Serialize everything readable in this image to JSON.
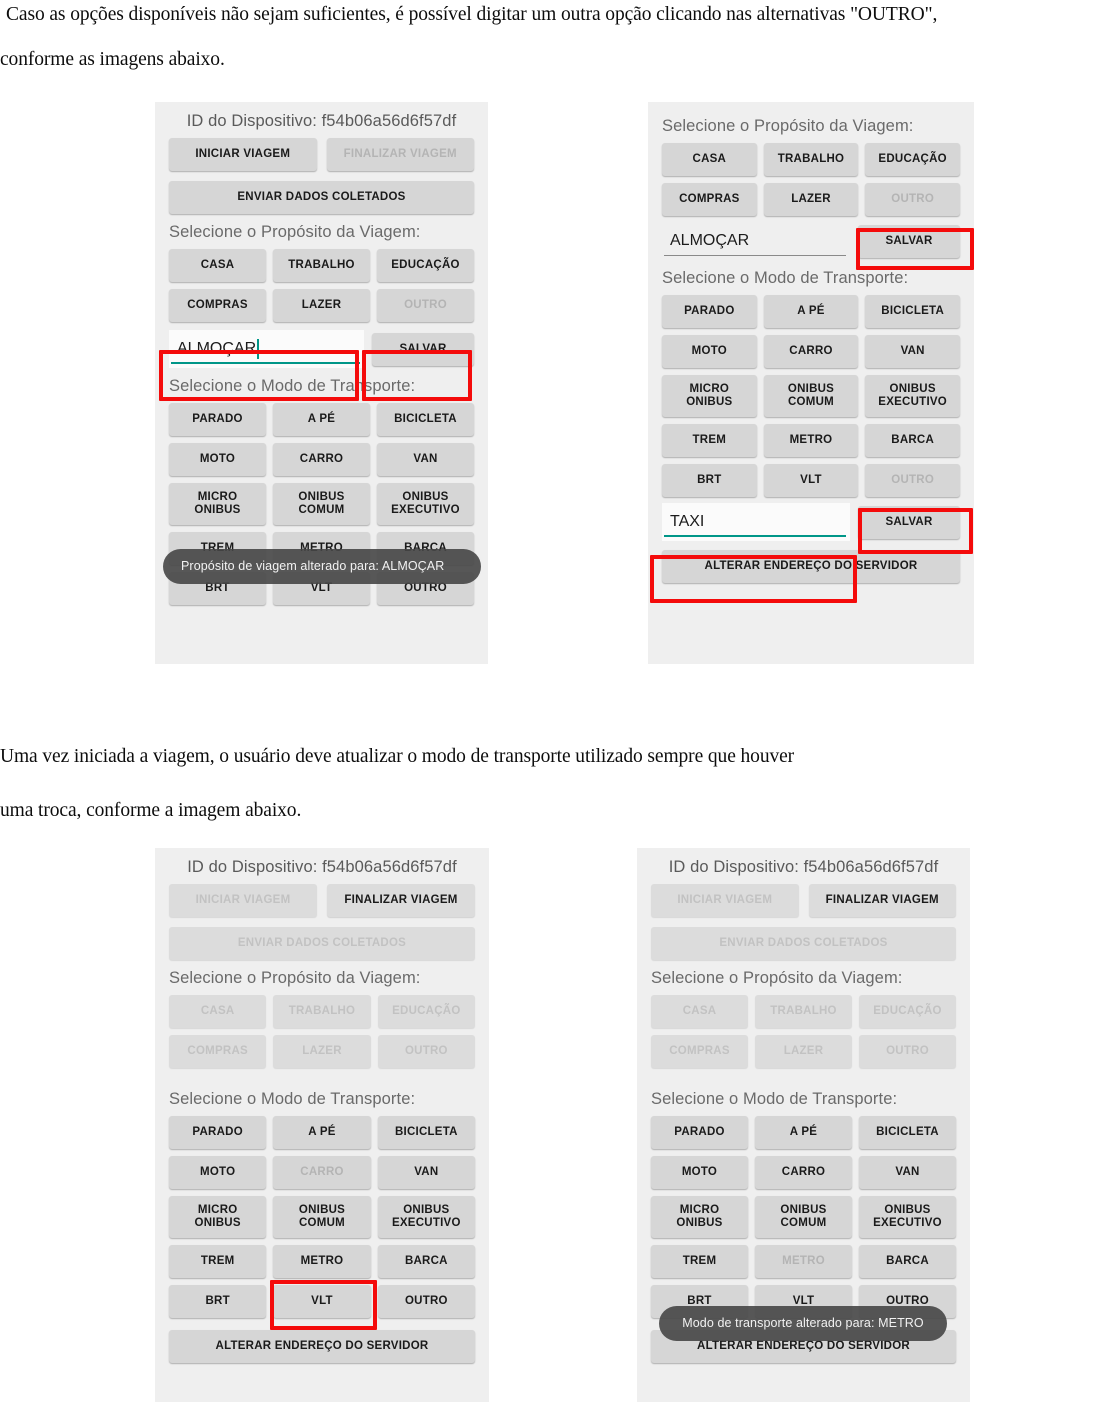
{
  "document": {
    "paragraph_1_line_1": "Caso as opções disponíveis não sejam suficientes, é possível digitar um outra opção clicando nas alternativas \"OUTRO\",",
    "paragraph_1_line_2": "conforme as imagens abaixo.",
    "paragraph_2_line_1": "Uma vez iniciada a viagem, o usuário deve atualizar o modo de transporte utilizado sempre que houver",
    "paragraph_2_line_2": "uma troca, conforme a imagem abaixo."
  },
  "labels": {
    "device_id": "ID do Dispositivo: f54b06a56d6f57df",
    "purpose_heading": "Selecione o Propósito da Viagem:",
    "transport_heading": "Selecione o Modo de Transporte:",
    "iniciar": "INICIAR VIAGEM",
    "finalizar": "FINALIZAR VIAGEM",
    "enviar": "ENVIAR DADOS COLETADOS",
    "alterar_servidor": "ALTERAR ENDEREÇO DO SERVIDOR",
    "salvar": "SALVAR",
    "purpose_options": [
      "CASA",
      "TRABALHO",
      "EDUCAÇÃO",
      "COMPRAS",
      "LAZER",
      "OUTRO"
    ],
    "transport_options": [
      "PARADO",
      "A PÉ",
      "BICICLETA",
      "MOTO",
      "CARRO",
      "VAN",
      "MICRO ONIBUS",
      "ONIBUS COMUM",
      "ONIBUS EXECUTIVO",
      "TREM",
      "METRO",
      "BARCA",
      "BRT",
      "VLT",
      "OUTRO"
    ]
  },
  "panel_1": {
    "device_id": "ID do Dispositivo: f54b06a56d6f57df",
    "iniciar": "INICIAR VIAGEM",
    "finalizar": "FINALIZAR VIAGEM",
    "enviar": "ENVIAR DADOS COLETADOS",
    "purpose_heading": "Selecione o Propósito da Viagem:",
    "purpose": [
      "CASA",
      "TRABALHO",
      "EDUCAÇÃO",
      "COMPRAS",
      "LAZER",
      "OUTRO"
    ],
    "input_value": "ALMOÇAR",
    "salvar": "SALVAR",
    "transport_heading": "Selecione o Modo de Transporte:",
    "transport": [
      "PARADO",
      "A PÉ",
      "BICICLETA",
      "MOTO",
      "CARRO",
      "VAN",
      "MICRO ONIBUS",
      "ONIBUS COMUM",
      "ONIBUS EXECUTIVO",
      "TREM",
      "METRO",
      "BARCA",
      "BRT",
      "VLT",
      "OUTRO"
    ],
    "toast": "Propósito de viagem alterado para: ALMOÇAR"
  },
  "panel_2": {
    "purpose_heading": "Selecione o Propósito da Viagem:",
    "purpose": [
      "CASA",
      "TRABALHO",
      "EDUCAÇÃO",
      "COMPRAS",
      "LAZER",
      "OUTRO"
    ],
    "purpose_input_value": "ALMOÇAR",
    "purpose_salvar": "SALVAR",
    "transport_heading": "Selecione o Modo de Transporte:",
    "transport": [
      "PARADO",
      "A PÉ",
      "BICICLETA",
      "MOTO",
      "CARRO",
      "VAN",
      "MICRO ONIBUS",
      "ONIBUS COMUM",
      "ONIBUS EXECUTIVO",
      "TREM",
      "METRO",
      "BARCA",
      "BRT",
      "VLT",
      "OUTRO"
    ],
    "transport_input_value": "TAXI",
    "transport_salvar": "SALVAR",
    "alterar_servidor": "ALTERAR ENDEREÇO DO SERVIDOR"
  },
  "panel_3": {
    "device_id": "ID do Dispositivo: f54b06a56d6f57df",
    "iniciar": "INICIAR VIAGEM",
    "finalizar": "FINALIZAR VIAGEM",
    "enviar": "ENVIAR DADOS COLETADOS",
    "purpose_heading": "Selecione o Propósito da Viagem:",
    "purpose": [
      "CASA",
      "TRABALHO",
      "EDUCAÇÃO",
      "COMPRAS",
      "LAZER",
      "OUTRO"
    ],
    "transport_heading": "Selecione o Modo de Transporte:",
    "transport": [
      "PARADO",
      "A PÉ",
      "BICICLETA",
      "MOTO",
      "CARRO",
      "VAN",
      "MICRO ONIBUS",
      "ONIBUS COMUM",
      "ONIBUS EXECUTIVO",
      "TREM",
      "METRO",
      "BARCA",
      "BRT",
      "VLT",
      "OUTRO"
    ],
    "alterar_servidor": "ALTERAR ENDEREÇO DO SERVIDOR"
  },
  "panel_4": {
    "device_id": "ID do Dispositivo: f54b06a56d6f57df",
    "iniciar": "INICIAR VIAGEM",
    "finalizar": "FINALIZAR VIAGEM",
    "enviar": "ENVIAR DADOS COLETADOS",
    "purpose_heading": "Selecione o Propósito da Viagem:",
    "purpose": [
      "CASA",
      "TRABALHO",
      "EDUCAÇÃO",
      "COMPRAS",
      "LAZER",
      "OUTRO"
    ],
    "transport_heading": "Selecione o Modo de Transporte:",
    "transport": [
      "PARADO",
      "A PÉ",
      "BICICLETA",
      "MOTO",
      "CARRO",
      "VAN",
      "MICRO ONIBUS",
      "ONIBUS COMUM",
      "ONIBUS EXECUTIVO",
      "TREM",
      "METRO",
      "BARCA",
      "BRT",
      "VLT",
      "OUTRO"
    ],
    "alterar_servidor": "ALTERAR ENDEREÇO DO SERVIDOR",
    "toast": "Modo de transporte alterado para: METRO"
  },
  "colors": {
    "annotation_red": "#f40b0b",
    "panel_background": "#efefef",
    "button_face": "#d6d6d6",
    "input_underline_active": "#009688",
    "toast_background": "rgba(70,70,70,0.90)"
  }
}
